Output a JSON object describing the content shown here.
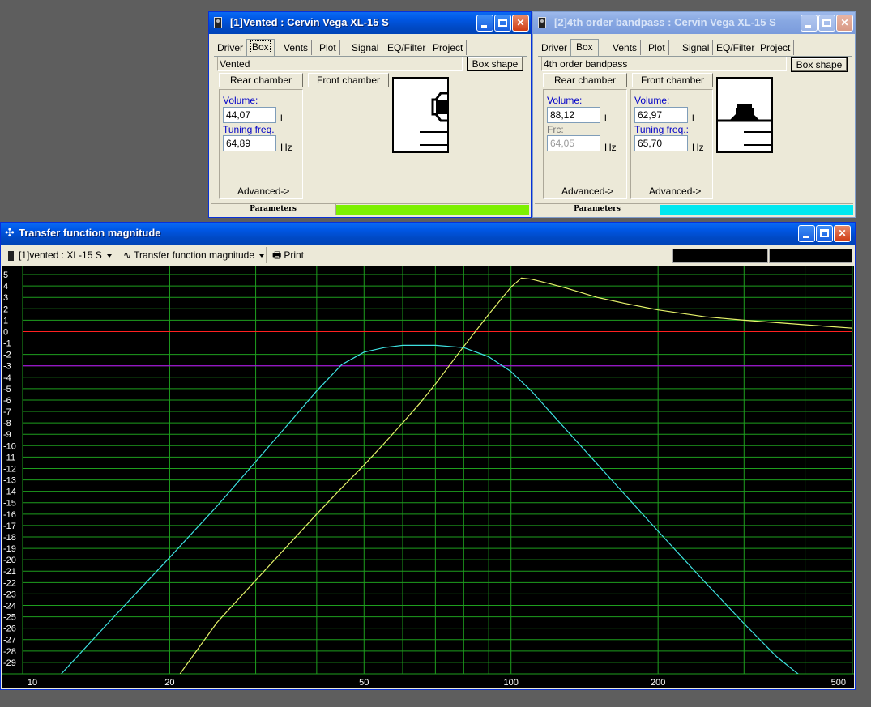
{
  "windows": [
    {
      "id": "vented",
      "title": "[1]Vented : Cervin Vega XL-15 S",
      "tabs": [
        "Driver",
        "Box",
        "Vents",
        "Plot",
        "Signal",
        "EQ/Filter",
        "Project"
      ],
      "active_tab": "Box",
      "box_type": "Vented",
      "box_shape_label": "Box shape",
      "rear_chamber_label": "Rear chamber",
      "front_chamber_label": "Front chamber",
      "rear": {
        "label1": "Volume:",
        "value1": "44,07",
        "unit1": "l",
        "label2": "Tuning freq.",
        "value2": "64,89",
        "unit2": "Hz",
        "advanced": "Advanced->"
      },
      "status_label": "Parameters",
      "status_color": "#7cf000"
    },
    {
      "id": "bandpass",
      "title": "[2]4th order bandpass : Cervin Vega XL-15 S",
      "tabs": [
        "Driver",
        "Box",
        "Vents",
        "Plot",
        "Signal",
        "EQ/Filter",
        "Project"
      ],
      "active_tab": "Box",
      "box_type": "4th order bandpass",
      "box_shape_label": "Box shape",
      "rear_chamber_label": "Rear chamber",
      "front_chamber_label": "Front chamber",
      "rear": {
        "label1": "Volume:",
        "value1": "88,12",
        "unit1": "l",
        "label2": "Frc:",
        "value2": "64,05",
        "unit2": "Hz",
        "advanced": "Advanced->"
      },
      "front": {
        "label1": "Volume:",
        "value1": "62,97",
        "unit1": "l",
        "label2": "Tuning freq.:",
        "value2": "65,70",
        "unit2": "Hz",
        "advanced": "Advanced->"
      },
      "status_label": "Parameters",
      "status_color": "#00e8f0"
    }
  ],
  "graph_window": {
    "title": "Transfer function magnitude",
    "toolbar": {
      "project_select": "[1]vented : XL-15 S",
      "graph_select": "Transfer function magnitude",
      "print_label": "Print"
    }
  },
  "chart_data": {
    "type": "line",
    "title": "Transfer function magnitude",
    "x_scale": "log",
    "xlim": [
      10,
      500
    ],
    "ylim": [
      -30,
      5.5
    ],
    "x_tick_labels": [
      10,
      20,
      50,
      100,
      200,
      500
    ],
    "y_tick_labels": [
      5,
      4,
      3,
      2,
      1,
      0,
      -1,
      -2,
      -3,
      -4,
      -5,
      -6,
      -7,
      -8,
      -9,
      -10,
      -11,
      -12,
      -13,
      -14,
      -15,
      -16,
      -17,
      -18,
      -19,
      -20,
      -21,
      -22,
      -23,
      -24,
      -25,
      -26,
      -27,
      -28,
      -29
    ],
    "grid": true,
    "reference_lines": [
      {
        "y": 0,
        "color": "#ff2020"
      },
      {
        "y": -3,
        "color": "#c000ff"
      }
    ],
    "series": [
      {
        "color": "#e6f26a",
        "x": [
          21,
          25,
          30,
          35,
          40,
          45,
          50,
          55,
          60,
          65,
          70,
          75,
          80,
          90,
          100,
          105,
          110,
          120,
          130,
          150,
          170,
          200,
          250,
          300,
          400,
          500
        ],
        "y": [
          -30,
          -25.5,
          -21.8,
          -18.7,
          -16,
          -13.7,
          -11.7,
          -9.8,
          -8,
          -6.3,
          -4.6,
          -2.9,
          -1.3,
          1.5,
          3.9,
          4.7,
          4.6,
          4.2,
          3.8,
          3,
          2.5,
          1.9,
          1.3,
          1,
          0.6,
          0.3
        ]
      },
      {
        "color": "#3ee0e0",
        "x": [
          12,
          15,
          20,
          25,
          30,
          35,
          40,
          45,
          50,
          55,
          60,
          70,
          80,
          90,
          100,
          110,
          120,
          150,
          200,
          250,
          300,
          350,
          400
        ],
        "y": [
          -30,
          -25.5,
          -19.8,
          -15.3,
          -11.4,
          -8.1,
          -5.2,
          -2.9,
          -1.8,
          -1.4,
          -1.2,
          -1.2,
          -1.4,
          -2.2,
          -3.5,
          -5.2,
          -7,
          -11.6,
          -17.5,
          -22,
          -25.6,
          -28.5,
          -30.5
        ]
      }
    ]
  }
}
